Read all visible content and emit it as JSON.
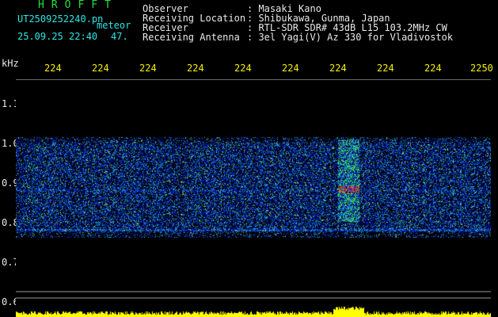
{
  "header": {
    "title": "HROFFT",
    "file_name": "UT2509252240.pn",
    "event_type": "meteor",
    "date_time": "25.09.25 22:40",
    "count": "47."
  },
  "station": [
    {
      "label": "Observer",
      "value": ": Masaki Kano"
    },
    {
      "label": "Receiving Location",
      "value": ": Shibukawa, Gunma, Japan"
    },
    {
      "label": "Receiver",
      "value": ": RTL-SDR SDR# 43dB L15 103.2MHz CW"
    },
    {
      "label": "Receiving Antenna",
      "value": ": 3el Yagi(V) Az 330 for Vladivostok"
    }
  ],
  "axes": {
    "freq_unit": "kHz",
    "time_ticks": [
      "224",
      "224",
      "224",
      "224",
      "224",
      "224",
      "224",
      "224",
      "224",
      "2250"
    ],
    "freq_ticks": [
      "1.1",
      "1.0",
      "0.9",
      "0.8",
      "0.7",
      "0.6"
    ]
  },
  "colors": {
    "background": "#000000",
    "label_cyan": "#2ee6e6",
    "label_white": "#e8e8e8",
    "tick_yellow": "#f4f000",
    "title_green": "#20e040",
    "signal_yellow": "#ffff00"
  }
}
